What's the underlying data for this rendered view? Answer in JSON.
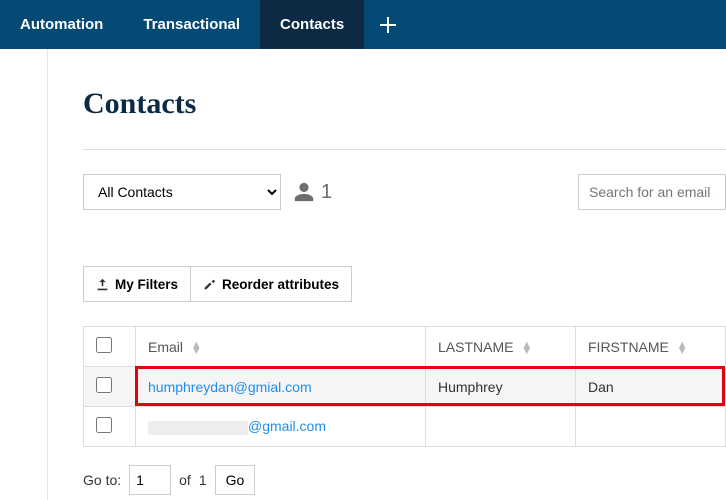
{
  "nav": {
    "items": [
      {
        "label": "Automation",
        "active": false
      },
      {
        "label": "Transactional",
        "active": false
      },
      {
        "label": "Contacts",
        "active": true
      }
    ]
  },
  "page": {
    "title": "Contacts"
  },
  "filter": {
    "selected": "All Contacts",
    "count": "1"
  },
  "search": {
    "placeholder": "Search for an email addr"
  },
  "toolbar": {
    "my_filters": "My Filters",
    "reorder": "Reorder attributes"
  },
  "table": {
    "headers": {
      "email": "Email",
      "lastname": "LASTNAME",
      "firstname": "FIRSTNAME"
    },
    "rows": [
      {
        "email": "humphreydan@gmial.com",
        "lastname": "Humphrey",
        "firstname": "Dan",
        "highlight": true,
        "redacted": false
      },
      {
        "email_visible": "@gmail.com",
        "lastname": "",
        "firstname": "",
        "highlight": false,
        "redacted": true
      }
    ]
  },
  "pager": {
    "goto_label": "Go to:",
    "page": "1",
    "of_label": "of",
    "total": "1",
    "go_label": "Go"
  }
}
